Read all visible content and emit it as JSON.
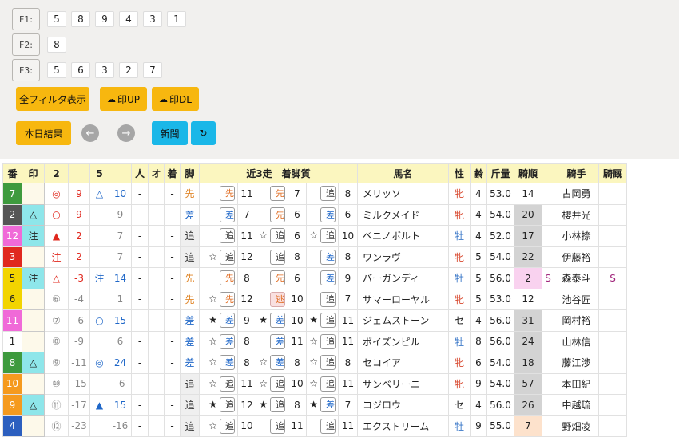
{
  "filters": [
    {
      "label": "F1:",
      "values": [
        "5",
        "8",
        "9",
        "4",
        "3",
        "1"
      ]
    },
    {
      "label": "F2:",
      "values": [
        "8"
      ]
    },
    {
      "label": "F3:",
      "values": [
        "5",
        "6",
        "3",
        "2",
        "7"
      ]
    }
  ],
  "buttons": {
    "all_filter": "全フィルタ表示",
    "up": "印UP",
    "dl": "印DL",
    "today": "本日結果",
    "prev": "←",
    "next": "→",
    "news": "新聞",
    "refresh": "↻"
  },
  "header": [
    "番",
    "印",
    "2",
    "",
    "5",
    "",
    "人",
    "オ",
    "着",
    "脚",
    "近3走　着脚質",
    "",
    "",
    "",
    "",
    "",
    "馬名",
    "性",
    "齢",
    "斤量",
    "騎順",
    "",
    "騎手",
    "騎厩"
  ],
  "colors": {
    "waku": [
      "#ffffff",
      "#222222",
      "#e0281e",
      "#2c5fbf",
      "#f2d400",
      "#3e9a3e",
      "#f59a1e",
      "#f06ad8"
    ]
  },
  "rows": [
    {
      "num": "7",
      "bg": "#3e9a3e",
      "mark": "",
      "m2": "◎",
      "v2": "9",
      "m5": "△",
      "v5": "10",
      "nin": "-",
      "o": "",
      "chaku": "-",
      "kyaku": "先",
      "r": [
        [
          "",
          "先",
          "11"
        ],
        [
          "",
          "先",
          "7"
        ],
        [
          "",
          "追",
          "8"
        ]
      ],
      "name": "メリッソ",
      "sex": "牝",
      "age": "4",
      "kin": "53.0",
      "jun": "14",
      "s": "",
      "jockey": "古岡勇",
      "stable": ""
    },
    {
      "num": "2",
      "bg": "#555555",
      "mark": "△",
      "m2": "○",
      "v2": "9",
      "m5": "",
      "v5": "9",
      "nin": "-",
      "o": "",
      "chaku": "-",
      "kyaku": "差",
      "r": [
        [
          "",
          "差",
          "7"
        ],
        [
          "",
          "先",
          "6"
        ],
        [
          "",
          "差",
          "6"
        ]
      ],
      "name": "ミルクメイド",
      "sex": "牝",
      "age": "4",
      "kin": "54.0",
      "jun": "20",
      "s": "",
      "jockey": "櫻井光",
      "stable": ""
    },
    {
      "num": "12",
      "bg": "#f06ad8",
      "mark": "注",
      "m2": "▲",
      "v2": "2",
      "m5": "",
      "v5": "7",
      "nin": "-",
      "o": "",
      "chaku": "-",
      "kyaku": "追",
      "r": [
        [
          "",
          "追",
          "11"
        ],
        [
          "☆",
          "追",
          "6"
        ],
        [
          "☆",
          "追",
          "10"
        ]
      ],
      "name": "ベニノボルト",
      "sex": "牡",
      "age": "4",
      "kin": "52.0",
      "jun": "17",
      "s": "",
      "jockey": "小林捺",
      "stable": ""
    },
    {
      "num": "3",
      "bg": "#e0281e",
      "mark": "",
      "m2": "注",
      "v2": "2",
      "m5": "",
      "v5": "7",
      "nin": "-",
      "o": "",
      "chaku": "-",
      "kyaku": "追",
      "r": [
        [
          "☆",
          "追",
          "12"
        ],
        [
          "",
          "追",
          "8"
        ],
        [
          "",
          "差",
          "8"
        ]
      ],
      "name": "ワンラヴ",
      "sex": "牝",
      "age": "5",
      "kin": "54.0",
      "jun": "22",
      "s": "",
      "jockey": "伊藤裕",
      "stable": ""
    },
    {
      "num": "5",
      "bg": "#f2d400",
      "mark": "注",
      "m2": "△",
      "v2": "-3",
      "m5": "注",
      "v5": "14",
      "nin": "-",
      "o": "",
      "chaku": "-",
      "kyaku": "先",
      "r": [
        [
          "",
          "先",
          "8"
        ],
        [
          "",
          "先",
          "6"
        ],
        [
          "",
          "差",
          "9"
        ]
      ],
      "name": "バーガンディ",
      "sex": "牡",
      "age": "5",
      "kin": "56.0",
      "jun": "2",
      "s": "S",
      "jockey": "森泰斗",
      "stable": "S"
    },
    {
      "num": "6",
      "bg": "#f2d400",
      "mark": "",
      "m2": "⑥",
      "v2": "-4",
      "m5": "",
      "v5": "1",
      "nin": "-",
      "o": "",
      "chaku": "-",
      "kyaku": "先",
      "r": [
        [
          "☆",
          "先",
          "12"
        ],
        [
          "",
          "逃",
          "10"
        ],
        [
          "",
          "追",
          "7"
        ]
      ],
      "name": "サマーローヤル",
      "sex": "牝",
      "age": "5",
      "kin": "53.0",
      "jun": "12",
      "s": "",
      "jockey": "池谷匠",
      "stable": ""
    },
    {
      "num": "11",
      "bg": "#f06ad8",
      "mark": "",
      "m2": "⑦",
      "v2": "-6",
      "m5": "○",
      "v5": "15",
      "nin": "-",
      "o": "",
      "chaku": "-",
      "kyaku": "差",
      "r": [
        [
          "★",
          "差",
          "9"
        ],
        [
          "★",
          "差",
          "10"
        ],
        [
          "★",
          "追",
          "11"
        ]
      ],
      "name": "ジェムストーン",
      "sex": "セ",
      "age": "4",
      "kin": "56.0",
      "jun": "31",
      "s": "",
      "jockey": "岡村裕",
      "stable": ""
    },
    {
      "num": "1",
      "bg": "#ffffff",
      "mark": "",
      "m2": "⑧",
      "v2": "-9",
      "m5": "",
      "v5": "6",
      "nin": "-",
      "o": "",
      "chaku": "-",
      "kyaku": "差",
      "r": [
        [
          "☆",
          "差",
          "8"
        ],
        [
          "",
          "差",
          "11"
        ],
        [
          "☆",
          "追",
          "11"
        ]
      ],
      "name": "ポイズンピル",
      "sex": "牡",
      "age": "8",
      "kin": "56.0",
      "jun": "24",
      "s": "",
      "jockey": "山林信",
      "stable": ""
    },
    {
      "num": "8",
      "bg": "#3e9a3e",
      "mark": "△",
      "m2": "⑨",
      "v2": "-11",
      "m5": "◎",
      "v5": "24",
      "nin": "-",
      "o": "",
      "chaku": "-",
      "kyaku": "差",
      "r": [
        [
          "☆",
          "差",
          "8"
        ],
        [
          "☆",
          "差",
          "8"
        ],
        [
          "☆",
          "追",
          "8"
        ]
      ],
      "name": "セコイア",
      "sex": "牝",
      "age": "6",
      "kin": "54.0",
      "jun": "18",
      "s": "",
      "jockey": "藤江渉",
      "stable": ""
    },
    {
      "num": "10",
      "bg": "#f59a1e",
      "mark": "",
      "m2": "⑩",
      "v2": "-15",
      "m5": "",
      "v5": "-6",
      "nin": "-",
      "o": "",
      "chaku": "-",
      "kyaku": "追",
      "r": [
        [
          "☆",
          "追",
          "11"
        ],
        [
          "☆",
          "追",
          "10"
        ],
        [
          "☆",
          "追",
          "11"
        ]
      ],
      "name": "サンベリーニ",
      "sex": "牝",
      "age": "9",
      "kin": "54.0",
      "jun": "57",
      "s": "",
      "jockey": "本田紀",
      "stable": ""
    },
    {
      "num": "9",
      "bg": "#f59a1e",
      "mark": "△",
      "m2": "⑪",
      "v2": "-17",
      "m5": "▲",
      "v5": "15",
      "nin": "-",
      "o": "",
      "chaku": "-",
      "kyaku": "追",
      "r": [
        [
          "★",
          "追",
          "12"
        ],
        [
          "★",
          "追",
          "8"
        ],
        [
          "★",
          "差",
          "7"
        ]
      ],
      "name": "コジロウ",
      "sex": "セ",
      "age": "4",
      "kin": "56.0",
      "jun": "26",
      "s": "",
      "jockey": "中越琉",
      "stable": ""
    },
    {
      "num": "4",
      "bg": "#2c5fbf",
      "mark": "",
      "m2": "⑫",
      "v2": "-23",
      "m5": "",
      "v5": "-16",
      "nin": "-",
      "o": "",
      "chaku": "-",
      "kyaku": "追",
      "r": [
        [
          "☆",
          "追",
          "10"
        ],
        [
          "",
          "追",
          "11"
        ],
        [
          "",
          "追",
          "11"
        ]
      ],
      "name": "エクストリーム",
      "sex": "牡",
      "age": "9",
      "kin": "55.0",
      "jun": "7",
      "s": "",
      "jockey": "野畑凌",
      "stable": ""
    }
  ]
}
